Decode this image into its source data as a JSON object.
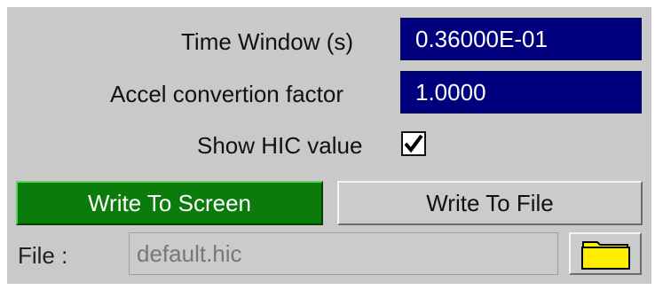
{
  "time_window": {
    "label": "Time Window (s)",
    "value": "0.36000E-01"
  },
  "accel_conversion": {
    "label": "Accel convertion factor",
    "value": "1.0000"
  },
  "show_hic": {
    "label": "Show HIC value",
    "checked": true
  },
  "buttons": {
    "write_screen": "Write To Screen",
    "write_file": "Write To File"
  },
  "file": {
    "label": "File :",
    "value": "default.hic"
  },
  "icons": {
    "checkbox": "checkmark-icon",
    "folder": "folder-icon"
  },
  "colors": {
    "panel": "#c9c9c9",
    "field": "#00007e",
    "active_button": "#0b7c0b",
    "folder": "#ffee00"
  }
}
